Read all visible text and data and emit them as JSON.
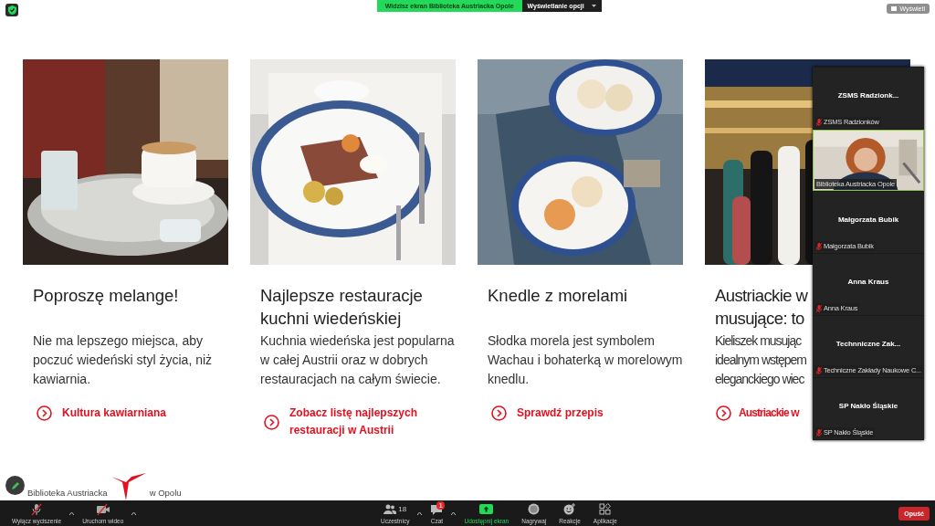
{
  "top_bar": {
    "share_banner": "Widzisz ekran Biblioteka Austriacka Opole",
    "view_options": "Wyświetlanie opcji",
    "view_button": "Wyświetl"
  },
  "cards": [
    {
      "title": "Poproszę melange!",
      "body": "Nie ma lepszego miejsca, aby poczuć wiedeński styl życia, niż kawiarnia.",
      "link": "Kultura kawiarniana"
    },
    {
      "title": "Najlepsze restauracje kuchni wiedeńskiej",
      "body": "Kuchnia wiedeńska jest popularna w całej Austrii oraz w dobrych restauracjach na całym świecie.",
      "link": "Zobacz listę najlepszych restauracji w Austrii"
    },
    {
      "title": "Knedle z morelami",
      "body": "Słodka morela jest symbolem Wachau i bohaterką w morelowym knedlu.",
      "link": "Sprawdź przepis"
    },
    {
      "title_lines": [
        "Austriackie w",
        "musujące: to"
      ],
      "body_lines": [
        "Kieliszek musując",
        "idealnym wstępem",
        "eleganckiego wiec"
      ],
      "link": "Austriackie w"
    }
  ],
  "footer": {
    "texts": [
      "Biblioteka Austriacka",
      "w Opolu"
    ]
  },
  "participants": [
    {
      "kind": "name",
      "display_name": "ZSMS  Radzionk...",
      "label": "ZSMS Radzionków",
      "muted": true,
      "speaking": false
    },
    {
      "kind": "video",
      "label": "Biblioteka Austriacka Opole",
      "muted": false,
      "speaking": true
    },
    {
      "kind": "name",
      "display_name": "Małgorzata Bubik",
      "label": "Małgorzata Bubik",
      "muted": true,
      "speaking": false
    },
    {
      "kind": "name",
      "display_name": "Anna Kraus",
      "label": "Anna Kraus",
      "muted": true,
      "speaking": false
    },
    {
      "kind": "name",
      "display_name": "Technniczne  Zak...",
      "label": "Techniczne Zakłady Naukowe C...",
      "muted": true,
      "speaking": false
    },
    {
      "kind": "name",
      "display_name": "SP Nakło Śląskie",
      "label": "SP Nakło Śląskie",
      "muted": true,
      "speaking": false
    }
  ],
  "toolbar": {
    "left": [
      {
        "kind": "mic",
        "label": "Wyłącz wyciszenie"
      },
      {
        "kind": "video",
        "label": "Uruchom wideo"
      }
    ],
    "center": [
      {
        "kind": "participants",
        "label": "Uczestnicy",
        "count": "18"
      },
      {
        "kind": "chat",
        "label": "Czat",
        "badge": "1"
      },
      {
        "kind": "share",
        "label": "Udostępnij ekran"
      },
      {
        "kind": "record",
        "label": "Nagrywaj"
      },
      {
        "kind": "reactions",
        "label": "Reakcje"
      },
      {
        "kind": "apps",
        "label": "Aplikacje"
      }
    ],
    "leave": "Opuść"
  }
}
